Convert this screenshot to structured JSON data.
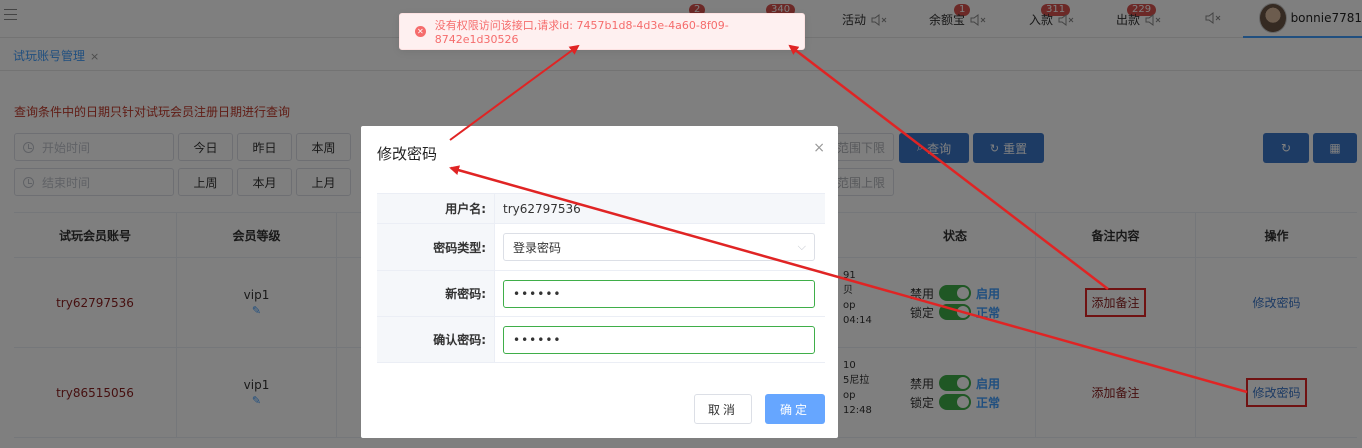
{
  "header": {
    "badges": [
      "2",
      "340",
      "1",
      "311",
      "229"
    ],
    "nav": [
      {
        "label": "活动",
        "icon": "mute-icon"
      },
      {
        "label": "余额宝",
        "icon": "mute-icon"
      },
      {
        "label": "入款",
        "icon": "mute-icon"
      },
      {
        "label": "出款",
        "icon": "mute-icon"
      },
      {
        "label": "",
        "icon": "mute-icon"
      }
    ],
    "username": "bonnie7781"
  },
  "tab": {
    "label": "试玩账号管理",
    "close": "×"
  },
  "notice": "查询条件中的日期只针对试玩会员注册日期进行查询",
  "filters": {
    "start_placeholder": "开始时间",
    "end_placeholder": "结束时间",
    "row1_buttons": [
      "今日",
      "昨日",
      "本周"
    ],
    "row2_buttons": [
      "上周",
      "本月",
      "上月"
    ],
    "range_lower": "范围下限",
    "range_upper": "范围上限",
    "search": "查询",
    "reset": "重置"
  },
  "table": {
    "headers": {
      "account": "试玩会员账号",
      "level": "会员等级",
      "status": "状态",
      "remark": "备注内容",
      "action": "操作"
    },
    "rows": [
      {
        "account": "try62797536",
        "level": "vip1",
        "frag": [
          "91",
          "贝",
          "op",
          "04:14"
        ],
        "disable": "禁用",
        "enable": "启用",
        "lock": "锁定",
        "normal": "正常",
        "remark": "添加备注",
        "action": "修改密码"
      },
      {
        "account": "try86515056",
        "level": "vip1",
        "frag": [
          "10",
          "5尼拉",
          "op",
          "12:48"
        ],
        "disable": "禁用",
        "enable": "启用",
        "lock": "锁定",
        "normal": "正常",
        "remark": "添加备注",
        "action": "修改密码"
      }
    ]
  },
  "dialog": {
    "title": "修改密码",
    "close": "×",
    "username_label": "用户名:",
    "username_value": "try62797536",
    "type_label": "密码类型:",
    "type_value": "登录密码",
    "new_label": "新密码:",
    "new_value": "••••••",
    "confirm_label": "确认密码:",
    "confirm_value": "••••••",
    "cancel": "取消",
    "ok": "确定"
  },
  "toast": {
    "message": "没有权限访问该接口,请求id: 7457b1d8-4d3e-4a60-8f09-8742e1d30526",
    "icon": "error-icon",
    "color": "#f56c6c"
  },
  "colors": {
    "primary": "#3a76c9",
    "switch_on": "#3fae49",
    "annotation": "#e02424"
  }
}
